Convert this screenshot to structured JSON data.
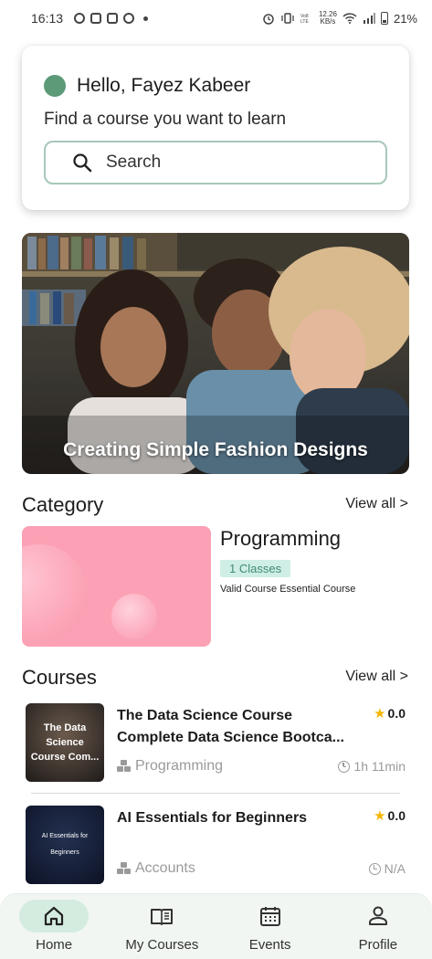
{
  "status_bar": {
    "time": "16:13",
    "net_speed_value": "12.26",
    "net_speed_unit": "KB/s",
    "battery": "21%"
  },
  "greeting": {
    "hello": "Hello, Fayez Kabeer",
    "subtitle": "Find a course you want to learn",
    "search_placeholder": "Search",
    "avatar_color": "#5c9a78"
  },
  "banner": {
    "title": "Creating Simple Fashion Designs"
  },
  "category_section": {
    "title": "Category",
    "view_all": "View all >",
    "item": {
      "name": "Programming",
      "classes": "1 Classes",
      "description": "Valid Course Essential Course",
      "image_color": "#fca1b5"
    }
  },
  "courses_section": {
    "title": "Courses",
    "view_all": "View all >",
    "items": [
      {
        "thumb_text": "The Data Science Course Com...",
        "title": "The Data Science Course Complete Data Science Bootca...",
        "rating": "0.0",
        "category": "Programming",
        "duration": "1h 11min"
      },
      {
        "thumb_text": "AI Essentials for Beginners",
        "title": "AI Essentials for Beginners",
        "rating": "0.0",
        "category": "Accounts",
        "duration": "N/A"
      }
    ]
  },
  "bottom_nav": {
    "items": [
      {
        "label": "Home",
        "icon": "home-icon",
        "active": true
      },
      {
        "label": "My Courses",
        "icon": "book-icon",
        "active": false
      },
      {
        "label": "Events",
        "icon": "calendar-icon",
        "active": false
      },
      {
        "label": "Profile",
        "icon": "person-icon",
        "active": false
      }
    ],
    "active_pill_color": "#d4ece0"
  },
  "colors": {
    "accent": "#5c9a78",
    "search_border": "#a6c8b8",
    "badge_bg": "#cfeee6",
    "badge_text": "#3f8a75",
    "star": "#f3b600"
  }
}
